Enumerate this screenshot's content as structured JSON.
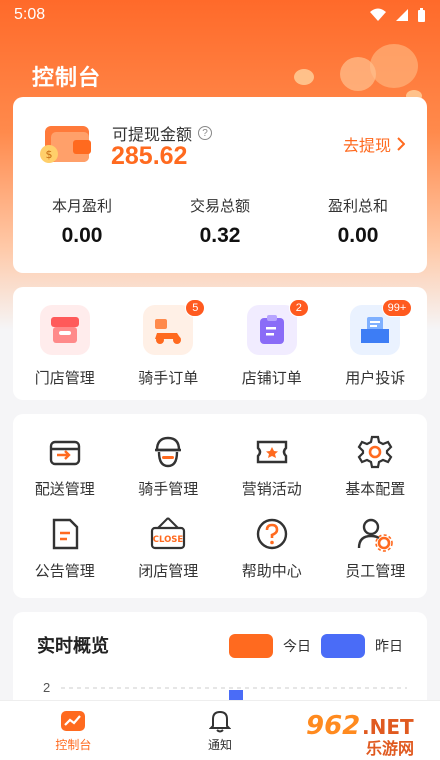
{
  "status_bar": {
    "time": "5:08"
  },
  "page_title": "控制台",
  "balance": {
    "label": "可提现金额",
    "help": "?",
    "amount": "285.62",
    "withdraw_label": "去提现"
  },
  "stats": [
    {
      "label": "本月盈利",
      "value": "0.00"
    },
    {
      "label": "交易总额",
      "value": "0.32"
    },
    {
      "label": "盈利总和",
      "value": "0.00"
    }
  ],
  "orders": [
    {
      "label": "门店管理",
      "badge": "",
      "icon": "store-icon"
    },
    {
      "label": "骑手订单",
      "badge": "5",
      "icon": "scooter-icon"
    },
    {
      "label": "店铺订单",
      "badge": "2",
      "icon": "clipboard-icon"
    },
    {
      "label": "用户投诉",
      "badge": "99+",
      "icon": "mail-tray-icon"
    }
  ],
  "menu": [
    {
      "label": "配送管理",
      "icon": "delivery-box-icon"
    },
    {
      "label": "骑手管理",
      "icon": "rider-icon"
    },
    {
      "label": "营销活动",
      "icon": "ticket-icon"
    },
    {
      "label": "基本配置",
      "icon": "gear-icon"
    },
    {
      "label": "公告管理",
      "icon": "document-icon"
    },
    {
      "label": "闭店管理",
      "icon": "close-sign-icon",
      "sign_text": "CLOSE"
    },
    {
      "label": "帮助中心",
      "icon": "help-icon"
    },
    {
      "label": "员工管理",
      "icon": "staff-gear-icon"
    }
  ],
  "overview": {
    "title": "实时概览",
    "legend": [
      {
        "name": "今日",
        "color": "#ff6a1f"
      },
      {
        "name": "昨日",
        "color": "#4a6cf7"
      }
    ]
  },
  "chart_data": {
    "type": "bar",
    "ytick_visible": "2",
    "series": [
      {
        "name": "今日",
        "color": "#ff6a1f"
      },
      {
        "name": "昨日",
        "color": "#4a6cf7"
      }
    ]
  },
  "tabbar": [
    {
      "label": "控制台",
      "active": true,
      "icon": "dashboard-icon"
    },
    {
      "label": "通知",
      "active": false,
      "icon": "bell-icon"
    }
  ],
  "watermark": {
    "number": "962",
    "suffix": ".NET",
    "text": "乐游网"
  },
  "colors": {
    "accent": "#ff6a1f",
    "blue": "#4a6cf7"
  }
}
